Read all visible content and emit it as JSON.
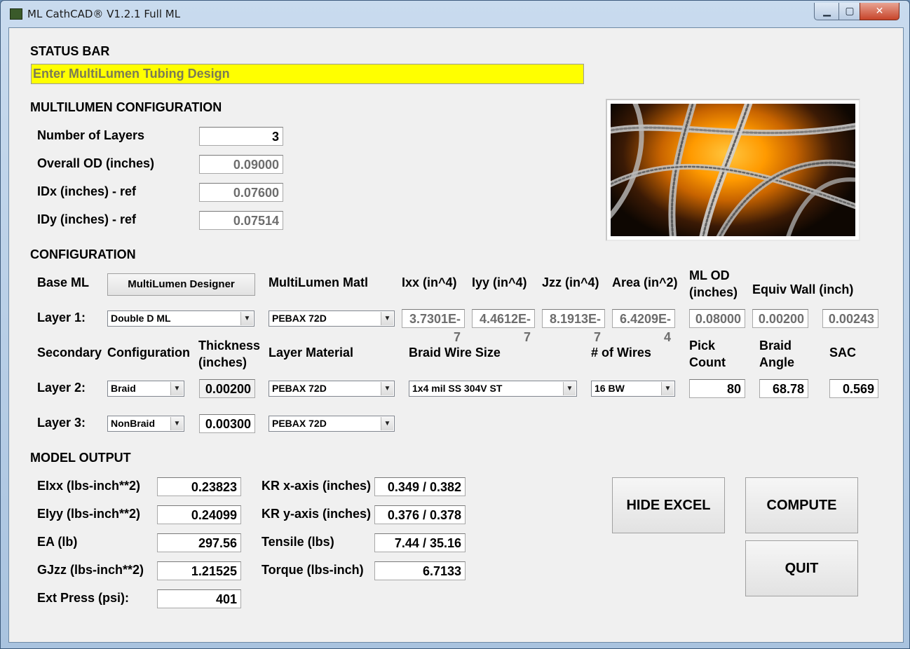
{
  "window": {
    "title": "ML CathCAD® V1.2.1 Full ML",
    "minimize_icon": "minimize-icon",
    "maximize_icon": "maximize-icon",
    "close_icon": "close-icon"
  },
  "status": {
    "heading": "STATUS BAR",
    "message": "Enter MultiLumen Tubing Design",
    "color": "#ffff00"
  },
  "ml_config": {
    "heading": "MULTILUMEN CONFIGURATION",
    "fields": [
      {
        "label": "Number of Layers",
        "value": "3"
      },
      {
        "label": "Overall OD (inches)",
        "value": "0.09000"
      },
      {
        "label": "IDx (inches) - ref",
        "value": "0.07600"
      },
      {
        "label": "IDy (inches) - ref",
        "value": "0.07514"
      }
    ]
  },
  "configuration": {
    "heading": "CONFIGURATION",
    "base_ml": "Base ML",
    "designer_button": "MultiLumen Designer",
    "headers": {
      "ml_matl": "MultiLumen Matl",
      "ixx": "Ixx (in^4)",
      "iyy": "Iyy (in^4)",
      "jzz": "Jzz (in^4)",
      "area": "Area (in^2)",
      "ml_od": "ML OD (inches)",
      "equiv_wall": "Equiv Wall (inch)",
      "secondary": "Secondary",
      "configuration": "Configuration",
      "thickness": "Thickness (inches)",
      "layer_material": "Layer Material",
      "braid_wire_size": "Braid Wire Size",
      "num_wires": "# of Wires",
      "pick_count": "Pick Count",
      "braid_angle": "Braid Angle",
      "sac": "SAC"
    },
    "layer1": {
      "label": "Layer 1:",
      "type": "Double D ML",
      "material": "PEBAX 72D",
      "ixx": "3.7301E-7",
      "iyy": "4.4612E-7",
      "jzz": "8.1913E-7",
      "area": "6.4209E-4",
      "ml_od": "0.08000",
      "equiv_wall": "0.00200",
      "extra": "0.00243"
    },
    "layer2": {
      "label": "Layer 2:",
      "config": "Braid",
      "thickness": "0.00200",
      "material": "PEBAX 72D",
      "wire": "1x4 mil SS 304V ST",
      "wires": "16 BW",
      "pick_count": "80",
      "braid_angle": "68.78",
      "sac": "0.569"
    },
    "layer3": {
      "label": "Layer 3:",
      "config": "NonBraid",
      "thickness": "0.00300",
      "material": "PEBAX 72D"
    }
  },
  "model_output": {
    "heading": "MODEL OUTPUT",
    "left": [
      {
        "label": "EIxx (lbs-inch**2)",
        "value": "0.23823"
      },
      {
        "label": "EIyy (lbs-inch**2)",
        "value": "0.24099"
      },
      {
        "label": "EA (lb)",
        "value": "297.56"
      },
      {
        "label": "GJzz (lbs-inch**2)",
        "value": "1.21525"
      },
      {
        "label": "Ext Press (psi):",
        "value": "401"
      }
    ],
    "right": [
      {
        "label": "KR x-axis (inches)",
        "value": "0.349 / 0.382"
      },
      {
        "label": "KR y-axis (inches)",
        "value": "0.376 / 0.378"
      },
      {
        "label": "Tensile (lbs)",
        "value": "7.44 / 35.16"
      },
      {
        "label": "Torque (lbs-inch)",
        "value": "6.7133"
      }
    ]
  },
  "buttons": {
    "hide_excel": "HIDE EXCEL",
    "compute": "COMPUTE",
    "quit": "QUIT"
  }
}
